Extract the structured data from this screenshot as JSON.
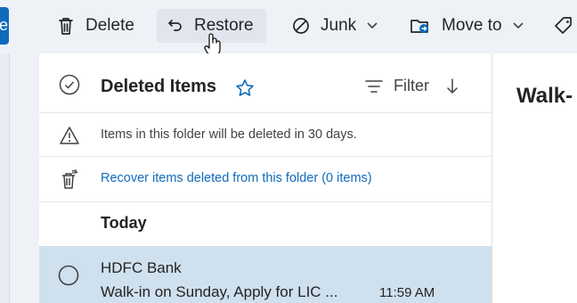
{
  "toolbar": {
    "new_label": "e",
    "delete_label": "Delete",
    "restore_label": "Restore",
    "junk_label": "Junk",
    "move_label": "Move to"
  },
  "folder": {
    "title": "Deleted Items",
    "filter_label": "Filter",
    "notice": "Items in this folder will be deleted in 30 days.",
    "recover_link": "Recover items deleted from this folder (0 items)"
  },
  "messages": {
    "group_today": "Today",
    "items": [
      {
        "sender": "HDFC Bank",
        "subject": "Walk-in on Sunday, Apply for LIC ...",
        "time": "11:59 AM"
      }
    ]
  },
  "reading_pane": {
    "title": "Walk-"
  },
  "colors": {
    "accent": "#0f6cbd",
    "selected_row": "#cfe0ee",
    "toolbar_bg": "#eef2f7"
  }
}
